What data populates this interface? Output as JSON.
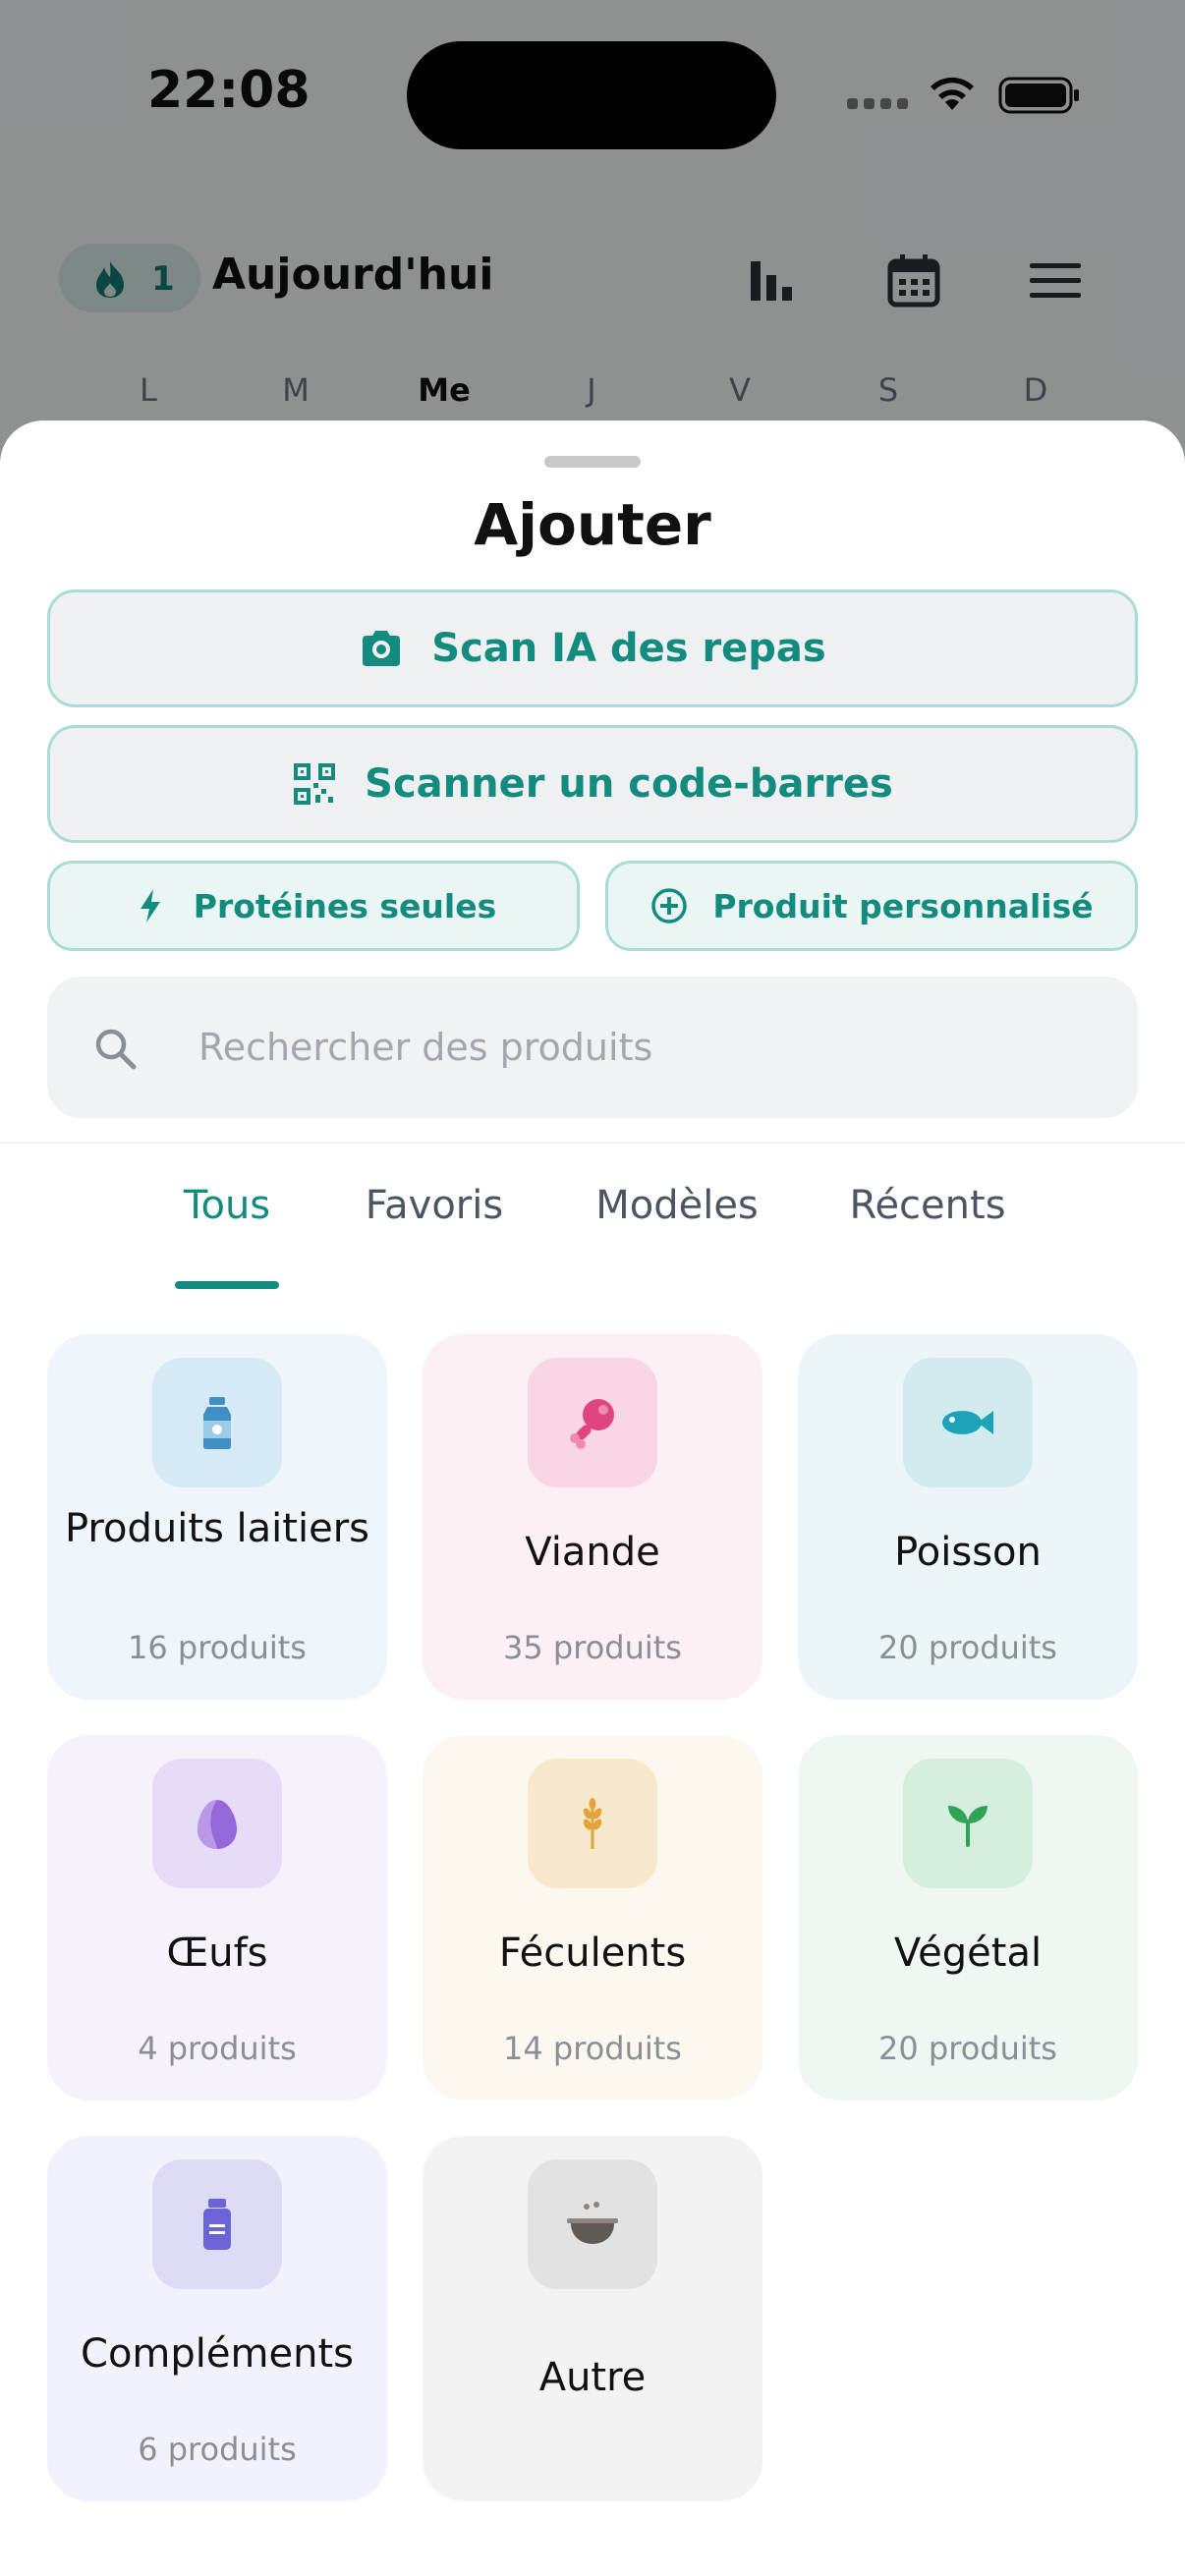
{
  "status_bar": {
    "time": "22:08"
  },
  "header": {
    "streak_count": "1",
    "title": "Aujourd'hui",
    "icons": [
      "chart-icon",
      "calendar-icon",
      "menu-icon"
    ]
  },
  "week_days": [
    "L",
    "M",
    "Me",
    "J",
    "V",
    "S",
    "D"
  ],
  "sheet": {
    "title": "Ajouter",
    "scan_ai_label": "Scan IA des repas",
    "barcode_label": "Scanner un code-barres",
    "protein_label": "Protéines seules",
    "custom_label": "Produit personnalisé",
    "search_placeholder": "Rechercher des produits",
    "tabs": [
      "Tous",
      "Favoris",
      "Modèles",
      "Récents"
    ],
    "categories": [
      {
        "name": "Produits laitiers",
        "count": "16 produits",
        "icon": "milk-bottle-icon"
      },
      {
        "name": "Viande",
        "count": "35 produits",
        "icon": "drumstick-icon"
      },
      {
        "name": "Poisson",
        "count": "20 produits",
        "icon": "fish-icon"
      },
      {
        "name": "Œufs",
        "count": "4 produits",
        "icon": "egg-icon"
      },
      {
        "name": "Féculents",
        "count": "14 produits",
        "icon": "wheat-icon"
      },
      {
        "name": "Végétal",
        "count": "20 produits",
        "icon": "sprout-icon"
      },
      {
        "name": "Compléments",
        "count": "6 produits",
        "icon": "supplement-jar-icon"
      },
      {
        "name": "Autre",
        "count": "",
        "icon": "bowl-icon"
      }
    ]
  },
  "colors": {
    "accent": "#138b7f",
    "accent_border": "#a9dcd4",
    "dairy_bg": "#eef6fb",
    "meat_bg": "#fcf0f4",
    "fish_bg": "#ecf6f8",
    "egg_bg": "#f5f2fc",
    "starch_bg": "#fcf8f0",
    "plant_bg": "#eef7f1",
    "supplement_bg": "#f2f2fc",
    "other_bg": "#f3f3f4"
  }
}
